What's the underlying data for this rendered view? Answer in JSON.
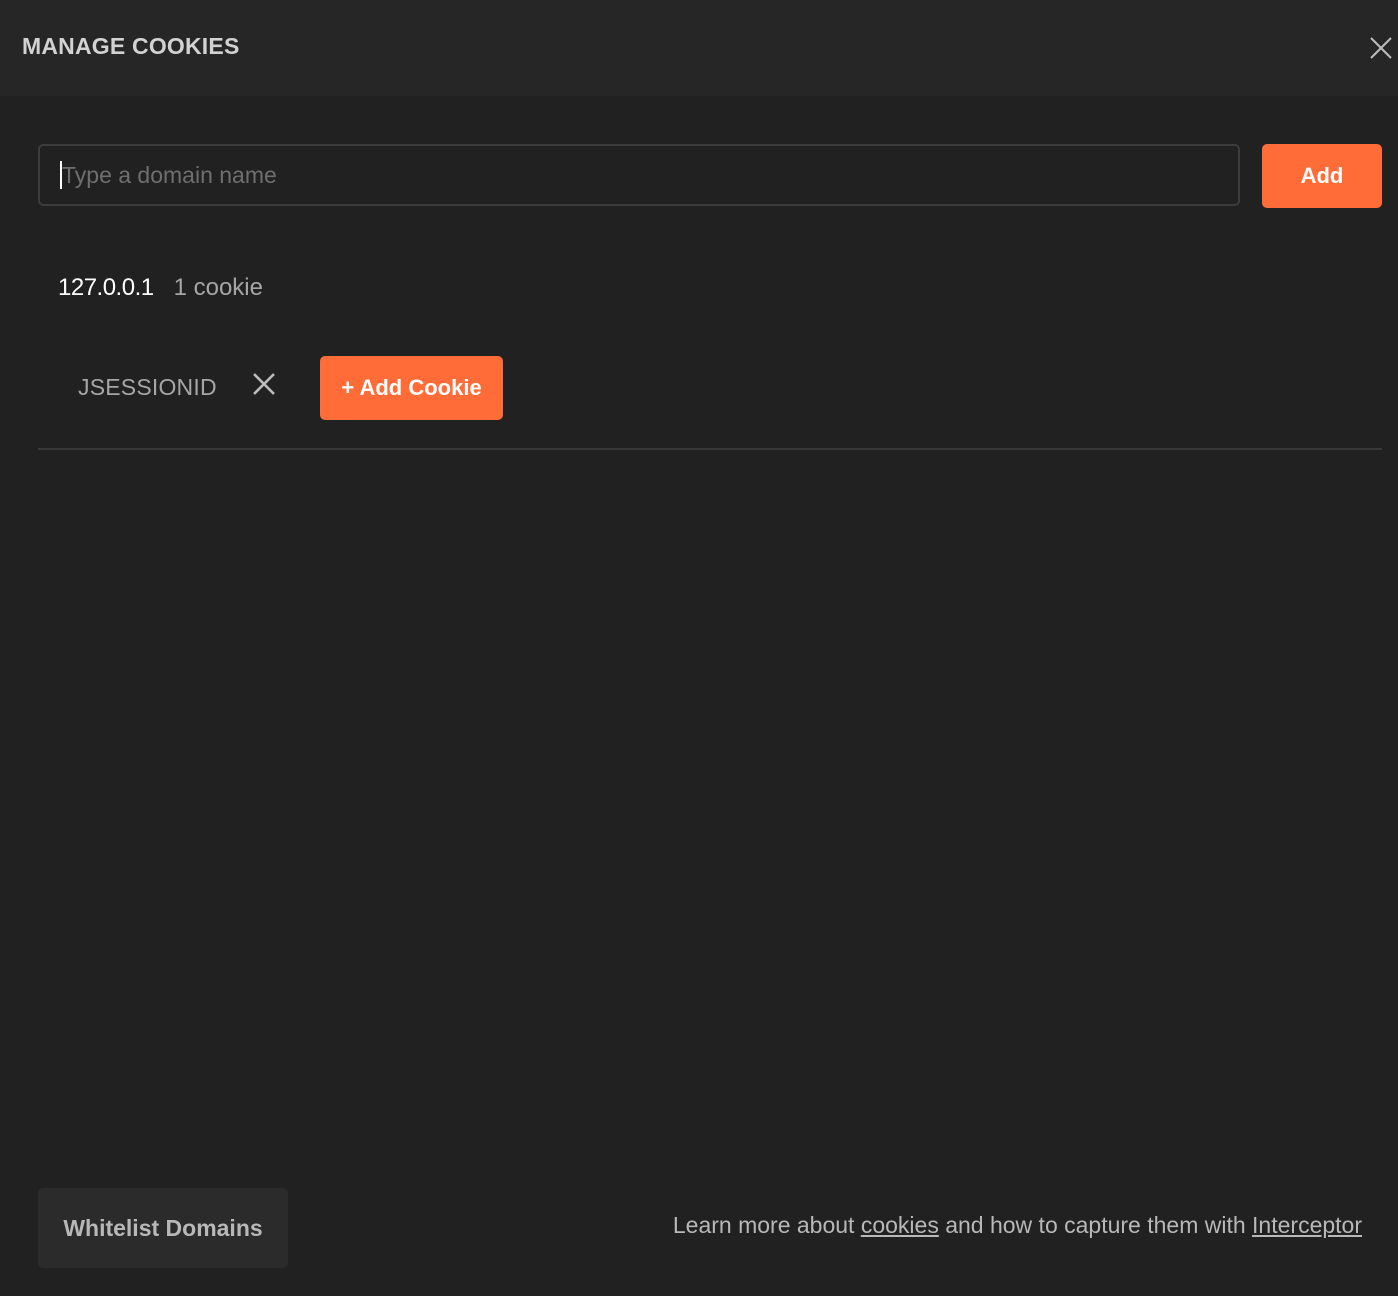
{
  "header": {
    "title": "MANAGE COOKIES",
    "close_icon": "close-icon"
  },
  "domain_input": {
    "placeholder": "Type a domain name",
    "value": ""
  },
  "add_button": {
    "label": "Add"
  },
  "domains": [
    {
      "name": "127.0.0.1",
      "count_label": "1 cookie",
      "cookies": [
        {
          "name": "JSESSIONID",
          "remove_icon": "close-icon"
        }
      ],
      "add_cookie_label": "+ Add Cookie"
    }
  ],
  "footer": {
    "whitelist_label": "Whitelist Domains",
    "text_before": "Learn more about ",
    "cookies_link": "cookies",
    "text_middle": " and how to capture them with ",
    "interceptor_link": "Interceptor"
  },
  "colors": {
    "accent": "#ff6c37",
    "background": "#212121",
    "header_background": "#262626"
  }
}
